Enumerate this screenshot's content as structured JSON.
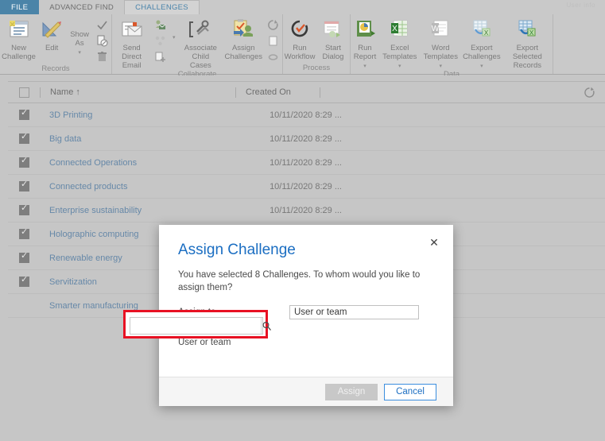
{
  "window": {
    "ghost_text": "User info"
  },
  "tabs": [
    {
      "label": "FILE",
      "state": "file"
    },
    {
      "label": "ADVANCED FIND",
      "state": "inactive"
    },
    {
      "label": "CHALLENGES",
      "state": "active"
    }
  ],
  "ribbon": {
    "groups": [
      {
        "name": "Records",
        "label": "Records",
        "buttons": [
          {
            "label": "New\nChallenge",
            "icon": "new-record-icon",
            "caret": false
          },
          {
            "label": "Edit",
            "icon": "edit-pencil-ruler-icon",
            "caret": false
          },
          {
            "label": "Show\nAs",
            "icon": "",
            "caret": true
          }
        ],
        "small_icons": [
          {
            "name": "activate-check-icon"
          },
          {
            "name": "deactivate-icon"
          },
          {
            "name": "delete-trash-icon"
          }
        ]
      },
      {
        "name": "Collaborate",
        "label": "Collaborate",
        "buttons": [
          {
            "label": "Send Direct\nEmail",
            "icon": "send-direct-email-icon",
            "caret": false
          },
          {
            "label": "Associate Child\nCases",
            "icon": "associate-child-cases-icon",
            "caret": false
          },
          {
            "label": "Assign\nChallenges",
            "icon": "assign-challenges-icon",
            "caret": false
          }
        ],
        "small_icons": [
          {
            "name": "email-contact-icon"
          },
          {
            "name": "connect-icon"
          },
          {
            "name": "add-to-queue-icon"
          },
          {
            "name": "share-icon"
          },
          {
            "name": "copy-link-icon"
          },
          {
            "name": "follow-icon"
          }
        ]
      },
      {
        "name": "Process",
        "label": "Process",
        "buttons": [
          {
            "label": "Run\nWorkflow",
            "icon": "run-workflow-icon",
            "caret": false
          },
          {
            "label": "Start\nDialog",
            "icon": "start-dialog-icon",
            "caret": false
          }
        ],
        "small_icons": []
      },
      {
        "name": "Data",
        "label": "Data",
        "buttons": [
          {
            "label": "Run\nReport",
            "icon": "run-report-icon",
            "caret": true
          },
          {
            "label": "Excel\nTemplates",
            "icon": "excel-templates-icon",
            "caret": true
          },
          {
            "label": "Word\nTemplates",
            "icon": "word-templates-icon",
            "caret": true
          },
          {
            "label": "Export\nChallenges",
            "icon": "export-challenges-icon",
            "caret": true
          },
          {
            "label": "Export Selected\nRecords",
            "icon": "export-selected-records-icon",
            "caret": false
          }
        ],
        "small_icons": []
      }
    ]
  },
  "grid": {
    "select_all_checked": false,
    "columns": [
      {
        "label": "Name",
        "sort": "↑"
      },
      {
        "label": "Created On",
        "sort": ""
      }
    ],
    "refresh_icon": "refresh-icon",
    "rows": [
      {
        "checked": true,
        "name": "3D Printing",
        "created_on": "10/11/2020 8:29 ..."
      },
      {
        "checked": true,
        "name": "Big data",
        "created_on": "10/11/2020 8:29 ..."
      },
      {
        "checked": true,
        "name": "Connected Operations",
        "created_on": "10/11/2020 8:29 ..."
      },
      {
        "checked": true,
        "name": "Connected products",
        "created_on": "10/11/2020 8:29 ..."
      },
      {
        "checked": true,
        "name": "Enterprise sustainability",
        "created_on": "10/11/2020 8:29 ..."
      },
      {
        "checked": true,
        "name": "Holographic computing",
        "created_on": ""
      },
      {
        "checked": true,
        "name": "Renewable energy",
        "created_on": ""
      },
      {
        "checked": true,
        "name": "Servitization",
        "created_on": ""
      },
      {
        "checked": false,
        "name": "Smarter manufacturing",
        "created_on": ""
      }
    ]
  },
  "dialog": {
    "title": "Assign Challenge",
    "close_label": "✕",
    "description": "You have selected 8 Challenges. To whom would you like to assign them?",
    "fields": {
      "assign_to": {
        "label": "Assign to",
        "value": "User or team"
      },
      "user_or_team": {
        "label": "User or team",
        "value": "",
        "placeholder": "",
        "search_icon": "search-icon"
      }
    },
    "buttons": {
      "assign": {
        "label": "Assign",
        "state": "disabled"
      },
      "cancel": {
        "label": "Cancel",
        "state": "enabled"
      }
    },
    "highlight_color": "#e81123"
  }
}
